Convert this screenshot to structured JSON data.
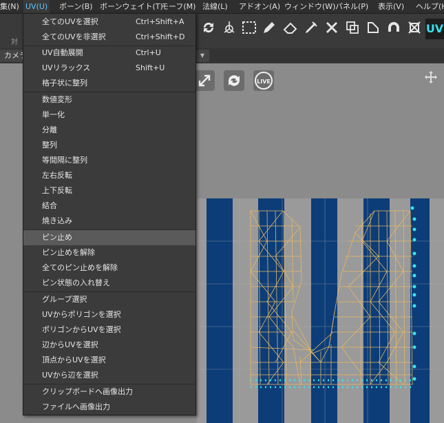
{
  "menubar": {
    "items": [
      {
        "label": "集(N)"
      },
      {
        "label": "UV(U)"
      },
      {
        "label": "ボーン(B)"
      },
      {
        "label": "ボーンウェイト(T)"
      },
      {
        "label": "モーフ(M)"
      },
      {
        "label": "法線(L)"
      },
      {
        "label": "アドオン(A)"
      },
      {
        "label": "ウィンドウ(W)"
      },
      {
        "label": "パネル(P)"
      },
      {
        "label": "表示(V)"
      },
      {
        "label": "ヘルプ(H"
      }
    ]
  },
  "toolbar": {
    "left_label": "対象",
    "uv_button": "UV"
  },
  "subbar": {
    "camera_tab": "カメラ",
    "dropdown": "▼"
  },
  "uv_menu": {
    "items": [
      {
        "label": "全てのUVを選択",
        "shortcut": "Ctrl+Shift+A"
      },
      {
        "label": "全てのUVを非選択",
        "shortcut": "Ctrl+Shift+D"
      },
      {
        "label": "UV自動展開",
        "shortcut": "Ctrl+U"
      },
      {
        "label": "UVリラックス",
        "shortcut": "Shift+U"
      },
      {
        "label": "格子状に整列",
        "shortcut": ""
      },
      {
        "label": "数値変形",
        "shortcut": ""
      },
      {
        "label": "単一化",
        "shortcut": ""
      },
      {
        "label": "分離",
        "shortcut": ""
      },
      {
        "label": "整列",
        "shortcut": ""
      },
      {
        "label": "等間隔に整列",
        "shortcut": ""
      },
      {
        "label": "左右反転",
        "shortcut": ""
      },
      {
        "label": "上下反転",
        "shortcut": ""
      },
      {
        "label": "結合",
        "shortcut": ""
      },
      {
        "label": "焼き込み",
        "shortcut": ""
      },
      {
        "label": "ピン止め",
        "shortcut": ""
      },
      {
        "label": "ピン止めを解除",
        "shortcut": ""
      },
      {
        "label": "全てのピン止めを解除",
        "shortcut": ""
      },
      {
        "label": "ピン状態の入れ替え",
        "shortcut": ""
      },
      {
        "label": "グループ選択",
        "shortcut": ""
      },
      {
        "label": "UVからポリゴンを選択",
        "shortcut": ""
      },
      {
        "label": "ポリゴンからUVを選択",
        "shortcut": ""
      },
      {
        "label": "辺からUVを選択",
        "shortcut": ""
      },
      {
        "label": "頂点からUVを選択",
        "shortcut": ""
      },
      {
        "label": "UVから辺を選択",
        "shortcut": ""
      },
      {
        "label": "クリップボードへ画像出力",
        "shortcut": ""
      },
      {
        "label": "ファイルへ画像出力",
        "shortcut": ""
      }
    ],
    "highlighted": "ピン止め"
  },
  "colors": {
    "accent": "#5ec8ff",
    "uv_edges": "#e8b860",
    "pinned_vertices": "#35e6f2",
    "texture_stripe": "#0d3d78"
  },
  "icons": {
    "toolbar": [
      "refresh-icon",
      "transform-gizmo-icon",
      "marquee-select-icon",
      "pen-icon",
      "eraser-icon",
      "brush-icon",
      "heal-icon",
      "boxes-icon",
      "corner-icon",
      "magnet-icon",
      "crop-icon"
    ],
    "viewport": [
      "expand-icon",
      "rotate-icon",
      "live-icon",
      "move-icon"
    ]
  }
}
